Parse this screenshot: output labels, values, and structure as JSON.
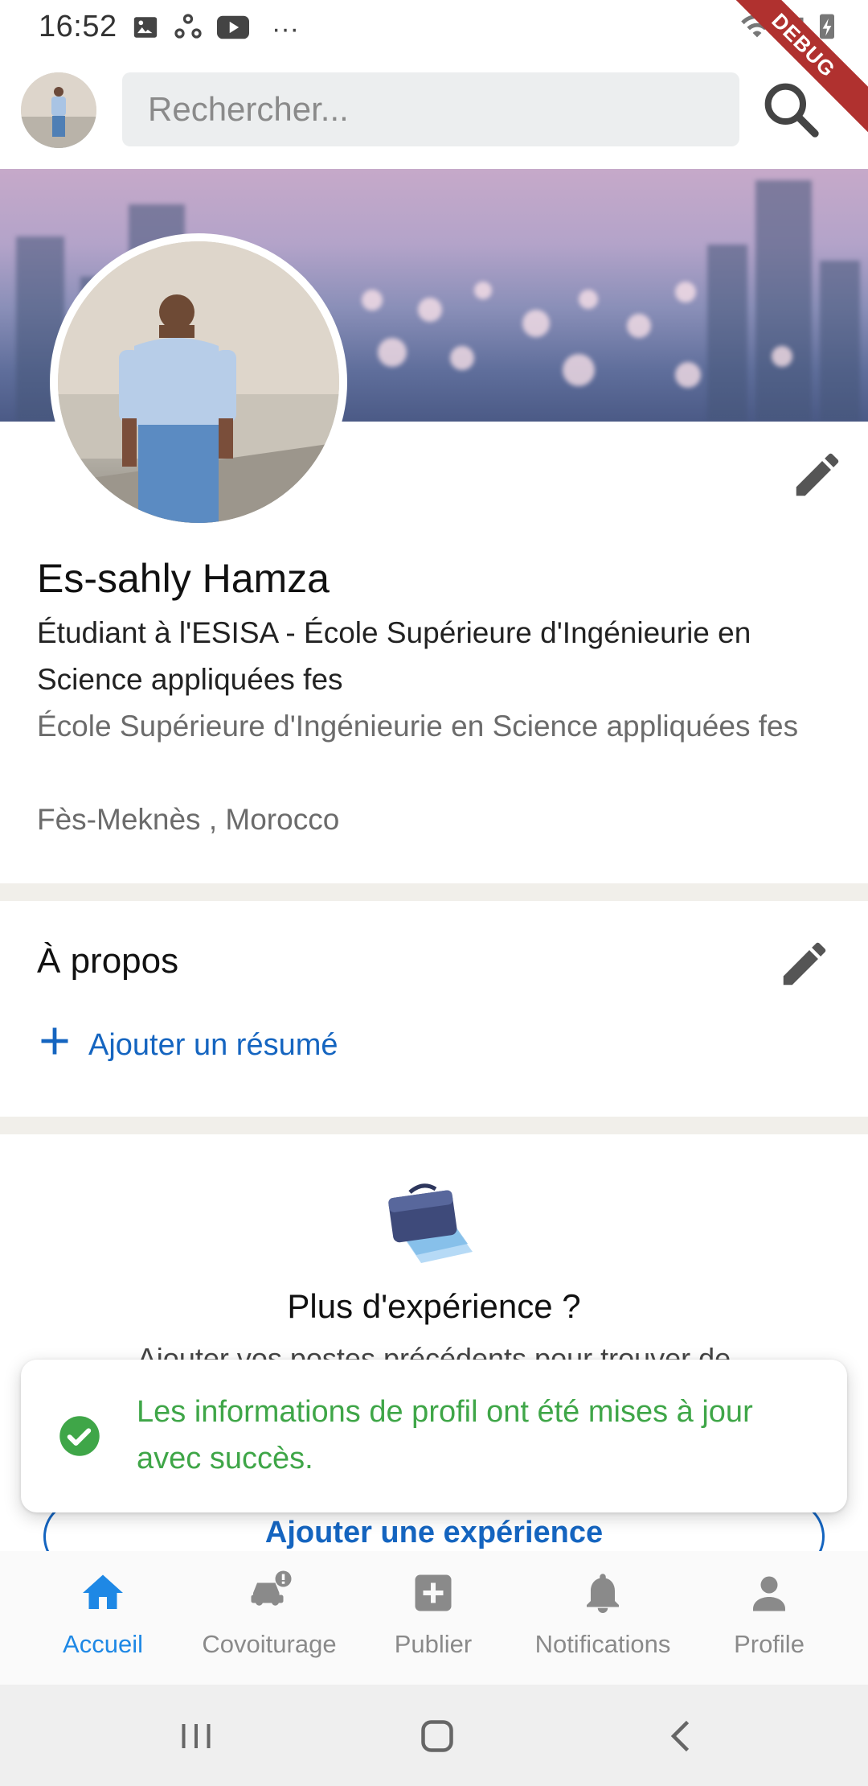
{
  "status_bar": {
    "time": "16:52",
    "overflow": "···",
    "debug_label": "DEBUG",
    "icons": [
      "gallery-icon",
      "sync-icon",
      "youtube-icon",
      "wifi-icon",
      "signal-icon",
      "battery-charging-icon"
    ]
  },
  "search": {
    "placeholder": "Rechercher..."
  },
  "profile": {
    "name": "Es-sahly Hamza",
    "headline": "Étudiant à l'ESISA - École Supérieure d'Ingénieurie en Science appliquées fes",
    "school": "École Supérieure d'Ingénieurie en Science appliquées fes",
    "location": "Fès-Meknès , Morocco"
  },
  "about": {
    "title": "À propos",
    "add_summary_label": "Ajouter un résumé"
  },
  "experience": {
    "title": "Plus d'expérience ?",
    "description": "Ajouter vos postes précédents pour trouver de",
    "button_label": "Ajouter une expérience"
  },
  "snackbar": {
    "message": "Les informations de profil ont été mises à jour avec succès."
  },
  "bottom_nav": {
    "items": [
      {
        "label": "Accueil",
        "icon": "home-icon",
        "active": true
      },
      {
        "label": "Covoiturage",
        "icon": "car-alert-icon",
        "active": false
      },
      {
        "label": "Publier",
        "icon": "add-box-icon",
        "active": false
      },
      {
        "label": "Notifications",
        "icon": "bell-icon",
        "active": false
      },
      {
        "label": "Profile",
        "icon": "person-icon",
        "active": false
      }
    ]
  },
  "colors": {
    "accent": "#1e88e5",
    "link": "#1565c0",
    "success": "#3fa648",
    "debug_ribbon": "#b0312f"
  }
}
